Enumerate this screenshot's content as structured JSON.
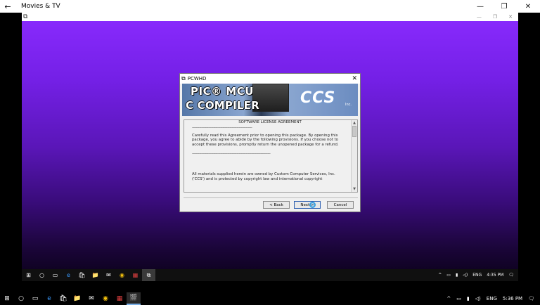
{
  "app": {
    "title": "Movies & TV",
    "back_glyph": "←",
    "minimize_glyph": "—",
    "restore_glyph": "❐",
    "close_glyph": "✕"
  },
  "vm_window": {
    "app_icon_glyph": "⧉",
    "caption_minimize": "—",
    "caption_restore": "❐",
    "caption_close": "✕"
  },
  "dialog": {
    "title": "PCWHD",
    "close_glyph": "✕",
    "banner": {
      "line1": "PIC® MCU",
      "line2": "C COMPILER",
      "logo": "CCS",
      "logo_suffix": "Inc."
    },
    "license": {
      "heading": "SOFTWARE LICENSE AGREEMENT",
      "rule": "-----------------------------------------------------------",
      "paragraph1": "Carefully read this Agreement prior to opening this package. By opening this package, you agree to abide by the following provisions. If you choose not to accept these provisions, promptly return the unopened package for a refund.",
      "rule2": "-----------------------------------------------------------------------------",
      "paragraph2": "All materials supplied herein are owned by Custom Computer Services, Inc. ('CCS') and is protected by copyright law and international copyright"
    },
    "buttons": {
      "back": "< Back",
      "next": "Next >",
      "cancel": "Cancel"
    }
  },
  "vm_taskbar": {
    "icons": [
      {
        "name": "start-icon",
        "glyph": "⊞"
      },
      {
        "name": "search-icon",
        "glyph": "○"
      },
      {
        "name": "task-view-icon",
        "glyph": "▭"
      },
      {
        "name": "edge-icon",
        "glyph": "e"
      },
      {
        "name": "store-icon",
        "glyph": "🛍"
      },
      {
        "name": "file-explorer-icon",
        "glyph": "📁"
      },
      {
        "name": "mail-icon",
        "glyph": "✉"
      },
      {
        "name": "chrome-icon",
        "glyph": "◉"
      },
      {
        "name": "app-icon",
        "glyph": "▦"
      },
      {
        "name": "installer-icon",
        "glyph": "⧉"
      }
    ],
    "tray": {
      "chevron": "^",
      "language": "ENG",
      "time": "4:35 PM",
      "notification_glyph": "🗨"
    }
  },
  "host_taskbar": {
    "icons": [
      {
        "name": "start-icon",
        "glyph": "⊞"
      },
      {
        "name": "search-icon",
        "glyph": "○"
      },
      {
        "name": "task-view-icon",
        "glyph": "▭"
      },
      {
        "name": "edge-icon",
        "glyph": "e"
      },
      {
        "name": "store-icon",
        "glyph": "🛍"
      },
      {
        "name": "file-explorer-icon",
        "glyph": "📁"
      },
      {
        "name": "mail-icon",
        "glyph": "✉"
      },
      {
        "name": "chrome-icon",
        "glyph": "◉"
      },
      {
        "name": "app-icon",
        "glyph": "▦"
      },
      {
        "name": "movies-tv-icon",
        "glyph": "🎬"
      }
    ],
    "tray": {
      "chevron": "^",
      "language": "ENG",
      "time": "5:36 PM",
      "notification_glyph": "🗨"
    }
  }
}
